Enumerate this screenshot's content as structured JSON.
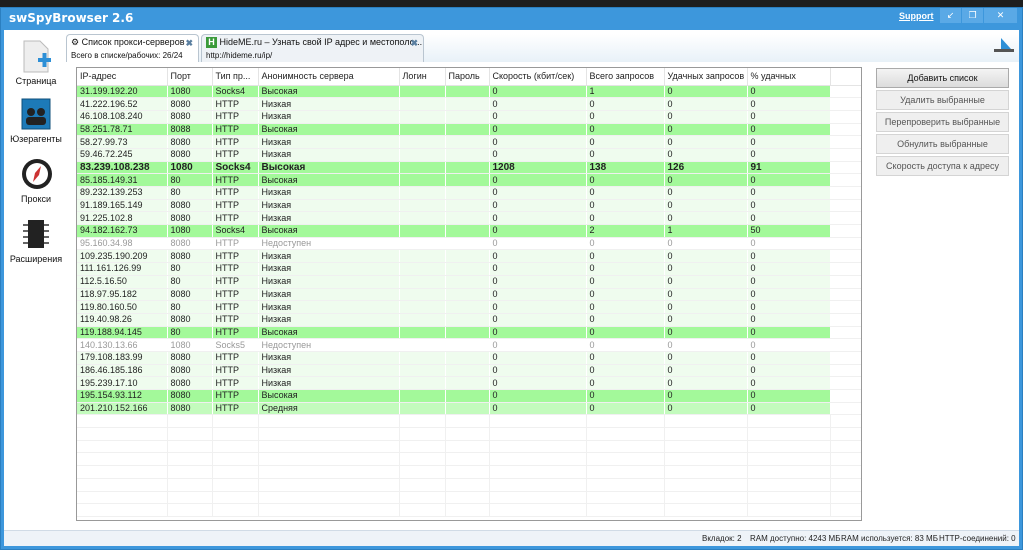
{
  "app": {
    "title": "swSpyBrowser 2.6",
    "support": "Support",
    "win_buttons": [
      "↙",
      "❐",
      "✕"
    ]
  },
  "sidebar": [
    {
      "label": "Страница",
      "icon": "page-add-icon"
    },
    {
      "label": "Юзерагенты",
      "icon": "users-icon"
    },
    {
      "label": "Прокси",
      "icon": "compass-icon"
    },
    {
      "label": "Расширения",
      "icon": "chip-icon"
    }
  ],
  "tabs": [
    {
      "title": "Список прокси-серверов",
      "subtitle": "Всего в списке/рабочих: 26/24",
      "icon": "gear-icon"
    },
    {
      "title": "HideME.ru – Узнать свой IP адрес и местополо...",
      "subtitle": "http://hideme.ru/ip/",
      "icon": "hideme-favicon-icon",
      "favicon_letter": "H"
    }
  ],
  "table": {
    "columns": [
      "IP-адрес",
      "Порт",
      "Тип пр...",
      "Анонимность сервера",
      "Логин",
      "Пароль",
      "Скорость (кбит/сек)",
      "Всего запросов",
      "Удачных запросов",
      "% удачных"
    ],
    "rows": [
      {
        "status": "high",
        "cells": [
          "31.199.192.20",
          "1080",
          "Socks4",
          "Высокая",
          "",
          "",
          "0",
          "1",
          "0",
          "0"
        ]
      },
      {
        "status": "low",
        "cells": [
          "41.222.196.52",
          "8080",
          "HTTP",
          "Низкая",
          "",
          "",
          "0",
          "0",
          "0",
          "0"
        ]
      },
      {
        "status": "low",
        "cells": [
          "46.108.108.240",
          "8080",
          "HTTP",
          "Низкая",
          "",
          "",
          "0",
          "0",
          "0",
          "0"
        ]
      },
      {
        "status": "high",
        "cells": [
          "58.251.78.71",
          "8088",
          "HTTP",
          "Высокая",
          "",
          "",
          "0",
          "0",
          "0",
          "0"
        ]
      },
      {
        "status": "low",
        "cells": [
          "58.27.99.73",
          "8080",
          "HTTP",
          "Низкая",
          "",
          "",
          "0",
          "0",
          "0",
          "0"
        ]
      },
      {
        "status": "low",
        "cells": [
          "59.46.72.245",
          "8080",
          "HTTP",
          "Низкая",
          "",
          "",
          "0",
          "0",
          "0",
          "0"
        ]
      },
      {
        "status": "bold",
        "cells": [
          "83.239.108.238",
          "1080",
          "Socks4",
          "Высокая",
          "",
          "",
          "1208",
          "138",
          "126",
          "91"
        ]
      },
      {
        "status": "high",
        "cells": [
          "85.185.149.31",
          "80",
          "HTTP",
          "Высокая",
          "",
          "",
          "0",
          "0",
          "0",
          "0"
        ]
      },
      {
        "status": "low",
        "cells": [
          "89.232.139.253",
          "80",
          "HTTP",
          "Низкая",
          "",
          "",
          "0",
          "0",
          "0",
          "0"
        ]
      },
      {
        "status": "low",
        "cells": [
          "91.189.165.149",
          "8080",
          "HTTP",
          "Низкая",
          "",
          "",
          "0",
          "0",
          "0",
          "0"
        ]
      },
      {
        "status": "low",
        "cells": [
          "91.225.102.8",
          "8080",
          "HTTP",
          "Низкая",
          "",
          "",
          "0",
          "0",
          "0",
          "0"
        ]
      },
      {
        "status": "high",
        "cells": [
          "94.182.162.73",
          "1080",
          "Socks4",
          "Высокая",
          "",
          "",
          "0",
          "2",
          "1",
          "50"
        ]
      },
      {
        "status": "unavail",
        "cells": [
          "95.160.34.98",
          "8080",
          "HTTP",
          "Недоступен",
          "",
          "",
          "0",
          "0",
          "0",
          "0"
        ]
      },
      {
        "status": "low",
        "cells": [
          "109.235.190.209",
          "8080",
          "HTTP",
          "Низкая",
          "",
          "",
          "0",
          "0",
          "0",
          "0"
        ]
      },
      {
        "status": "low",
        "cells": [
          "111.161.126.99",
          "80",
          "HTTP",
          "Низкая",
          "",
          "",
          "0",
          "0",
          "0",
          "0"
        ]
      },
      {
        "status": "low",
        "cells": [
          "112.5.16.50",
          "80",
          "HTTP",
          "Низкая",
          "",
          "",
          "0",
          "0",
          "0",
          "0"
        ]
      },
      {
        "status": "low",
        "cells": [
          "118.97.95.182",
          "8080",
          "HTTP",
          "Низкая",
          "",
          "",
          "0",
          "0",
          "0",
          "0"
        ]
      },
      {
        "status": "low",
        "cells": [
          "119.80.160.50",
          "80",
          "HTTP",
          "Низкая",
          "",
          "",
          "0",
          "0",
          "0",
          "0"
        ]
      },
      {
        "status": "low",
        "cells": [
          "119.40.98.26",
          "8080",
          "HTTP",
          "Низкая",
          "",
          "",
          "0",
          "0",
          "0",
          "0"
        ]
      },
      {
        "status": "high",
        "cells": [
          "119.188.94.145",
          "80",
          "HTTP",
          "Высокая",
          "",
          "",
          "0",
          "0",
          "0",
          "0"
        ]
      },
      {
        "status": "unavail",
        "cells": [
          "140.130.13.66",
          "1080",
          "Socks5",
          "Недоступен",
          "",
          "",
          "0",
          "0",
          "0",
          "0"
        ]
      },
      {
        "status": "low",
        "cells": [
          "179.108.183.99",
          "8080",
          "HTTP",
          "Низкая",
          "",
          "",
          "0",
          "0",
          "0",
          "0"
        ]
      },
      {
        "status": "low",
        "cells": [
          "186.46.185.186",
          "8080",
          "HTTP",
          "Низкая",
          "",
          "",
          "0",
          "0",
          "0",
          "0"
        ]
      },
      {
        "status": "low",
        "cells": [
          "195.239.17.10",
          "8080",
          "HTTP",
          "Низкая",
          "",
          "",
          "0",
          "0",
          "0",
          "0"
        ]
      },
      {
        "status": "high",
        "cells": [
          "195.154.93.112",
          "8080",
          "HTTP",
          "Высокая",
          "",
          "",
          "0",
          "0",
          "0",
          "0"
        ]
      },
      {
        "status": "medium",
        "cells": [
          "201.210.152.166",
          "8080",
          "HTTP",
          "Средняя",
          "",
          "",
          "0",
          "0",
          "0",
          "0"
        ]
      }
    ]
  },
  "buttons": [
    "Добавить список",
    "Удалить выбранные",
    "Перепроверить выбранные",
    "Обнулить выбранные",
    "Скорость доступа к адресу"
  ],
  "status": {
    "tabs": "Вкладок: 2",
    "ram_free": "RAM доступно: 4243 МБ",
    "ram_used": "RAM используется: 83 МБ",
    "http": "HTTP-соединений: 0"
  }
}
